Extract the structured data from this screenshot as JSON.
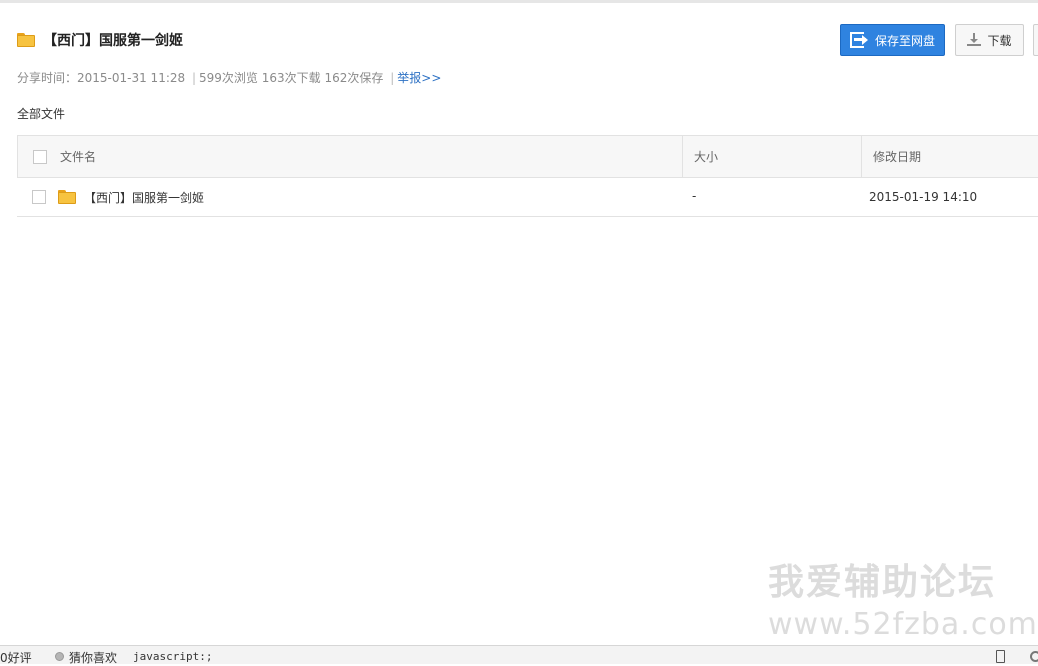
{
  "header": {
    "title": "【西门】国服第一剑姬",
    "save_button": "保存至网盘",
    "download_button": "下载"
  },
  "meta": {
    "share_time": "分享时间：2015-01-31 11:28",
    "separator": "|",
    "views": "599次浏览",
    "downloads": "163次下载",
    "saves": "162次保存",
    "report": "举报>>"
  },
  "breadcrumb": "全部文件",
  "table": {
    "columns": {
      "name": "文件名",
      "size": "大小",
      "modified": "修改日期"
    },
    "rows": [
      {
        "name": "【西门】国服第一剑姬",
        "size": "-",
        "modified": "2015-01-19 14:10"
      }
    ]
  },
  "watermark": {
    "cn": "我爱辅助论坛",
    "en": "www.52fzba.com"
  },
  "statusbar": {
    "good": "0好评",
    "guess": "猜你喜欢",
    "js": "javascript:;"
  },
  "colors": {
    "accent": "#2f83e0",
    "folder": "#f7c340",
    "link": "#2d71c4"
  }
}
